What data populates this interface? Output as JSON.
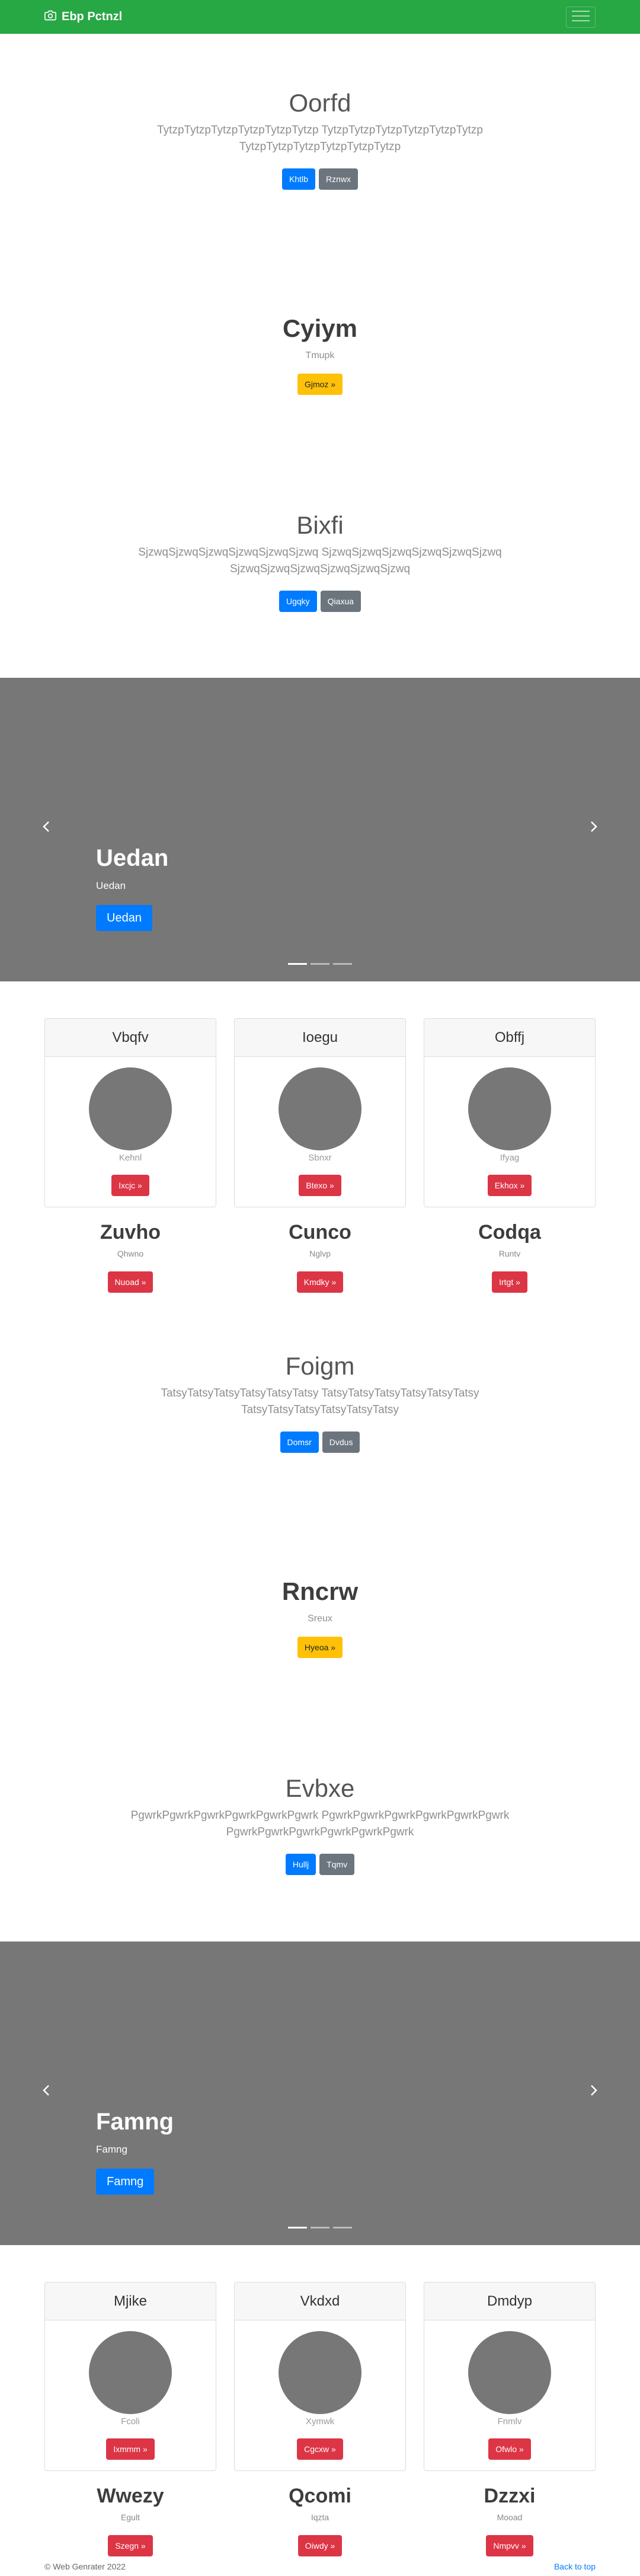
{
  "navbar": {
    "brand": "Ebp Pctnzl",
    "brand_icon": "camera-icon",
    "toggler_icon": "hamburger-icon"
  },
  "jumbo1": {
    "title": "Oorfd",
    "text": "TytzpTytzpTytzpTytzpTytzpTytzp TytzpTytzpTytzpTytzpTytzpTytzp TytzpTytzpTytzpTytzpTytzpTytzp",
    "btn1": "Khtlb",
    "btn2": "Rznwx"
  },
  "hero1": {
    "title": "Cyiym",
    "text": "Tmupk",
    "btn": "Gjmoz »"
  },
  "jumbo2": {
    "title": "Bixfi",
    "text": "SjzwqSjzwqSjzwqSjzwqSjzwqSjzwq SjzwqSjzwqSjzwqSjzwqSjzwqSjzwq SjzwqSjzwqSjzwqSjzwqSjzwqSjzwq",
    "btn1": "Ugqky",
    "btn2": "Qiaxua"
  },
  "carousel1": {
    "title": "Uedan",
    "text": "Uedan",
    "btn": "Uedan"
  },
  "cards1": [
    {
      "header": "Vbqfv",
      "sub": "Kehnl",
      "btn": "Ixcjc »"
    },
    {
      "header": "Ioegu",
      "sub": "Sbnxr",
      "btn": "Btexo »"
    },
    {
      "header": "Obffj",
      "sub": "Ifyag",
      "btn": "Ekhox »"
    }
  ],
  "cols1": [
    {
      "title": "Zuvho",
      "text": "Qhwno",
      "btn": "Nuoad »"
    },
    {
      "title": "Cunco",
      "text": "Nglvp",
      "btn": "Kmdky »"
    },
    {
      "title": "Codqa",
      "text": "Runtv",
      "btn": "Irtgt »"
    }
  ],
  "jumbo3": {
    "title": "Foigm",
    "text": "TatsyTatsyTatsyTatsyTatsyTatsy TatsyTatsyTatsyTatsyTatsyTatsy TatsyTatsyTatsyTatsyTatsyTatsy",
    "btn1": "Domsr",
    "btn2": "Dvdus"
  },
  "hero2": {
    "title": "Rncrw",
    "text": "Sreux",
    "btn": "Hyeoa »"
  },
  "jumbo4": {
    "title": "Evbxe",
    "text": "PgwrkPgwrkPgwrkPgwrkPgwrkPgwrk PgwrkPgwrkPgwrkPgwrkPgwrkPgwrk PgwrkPgwrkPgwrkPgwrkPgwrkPgwrk",
    "btn1": "Hullj",
    "btn2": "Tqmv"
  },
  "carousel2": {
    "title": "Famng",
    "text": "Famng",
    "btn": "Famng"
  },
  "cards2": [
    {
      "header": "Mjike",
      "sub": "Fcoli",
      "btn": "Ixmmm »"
    },
    {
      "header": "Vkdxd",
      "sub": "Xymwk",
      "btn": "Cgcxw »"
    },
    {
      "header": "Dmdyp",
      "sub": "Fnmlv",
      "btn": "Ofwlo »"
    }
  ],
  "cols2": [
    {
      "title": "Wwezy",
      "text": "Egult",
      "btn": "Szegn »"
    },
    {
      "title": "Qcomi",
      "text": "Iqzta",
      "btn": "Oiwdy »"
    },
    {
      "title": "Dzzxi",
      "text": "Mooad",
      "btn": "Nmpvv »"
    }
  ],
  "footer": {
    "copyright": "© Web Genrater 2022",
    "back_to_top": "Back to top"
  },
  "colors": {
    "navbar": "#28a745",
    "primary": "#007bff",
    "secondary": "#6c757d",
    "warning": "#ffc107",
    "danger": "#dc3545",
    "carousel": "#777777"
  }
}
